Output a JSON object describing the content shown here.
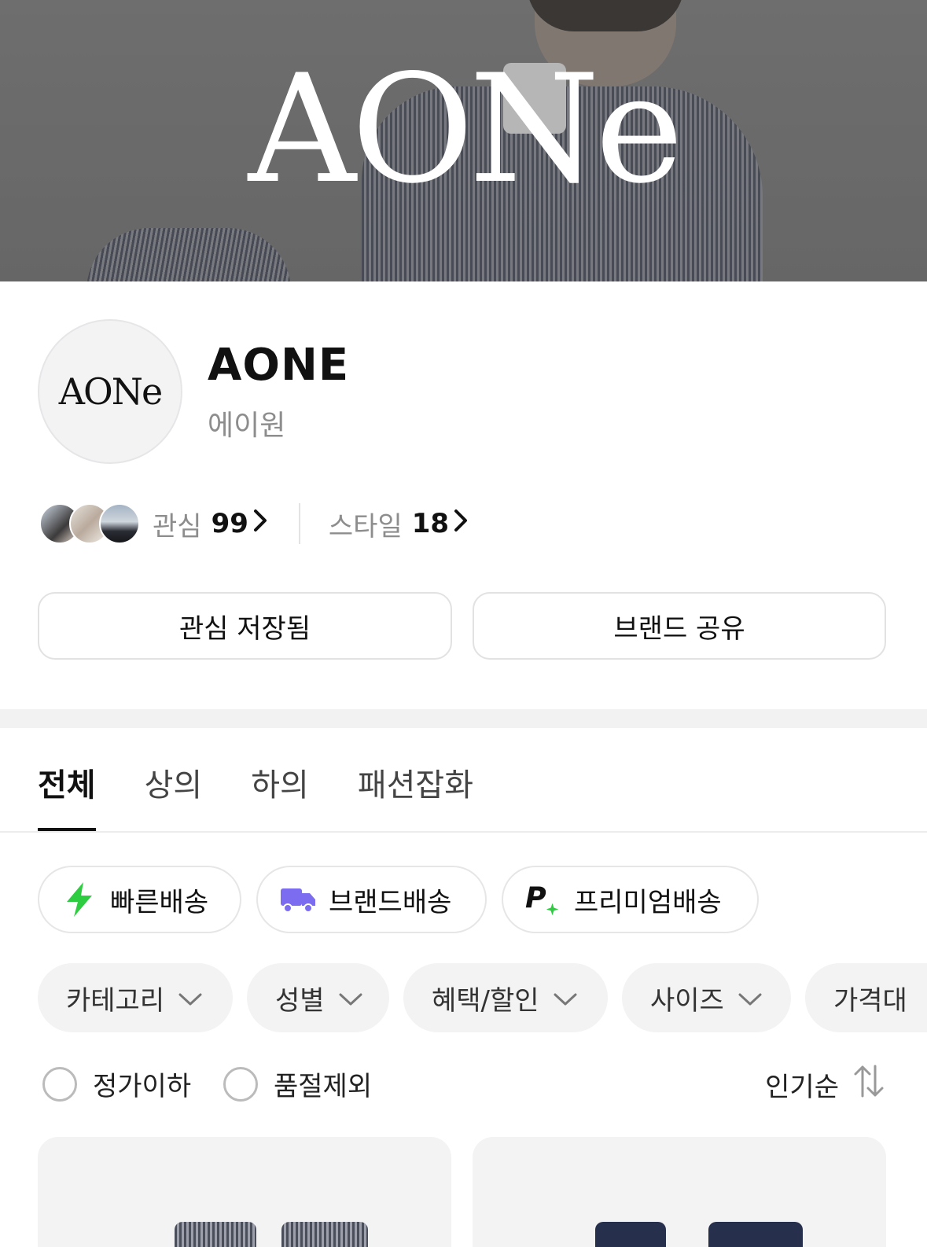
{
  "banner": {
    "logo_text": "AONe"
  },
  "brand": {
    "logo_text": "AONe",
    "name": "AONE",
    "name_kr": "에이원"
  },
  "stats": {
    "interest_label": "관심",
    "interest_count": "99",
    "style_label": "스타일",
    "style_count": "18"
  },
  "actions": {
    "saved_label": "관심 저장됨",
    "share_label": "브랜드 공유"
  },
  "tabs": [
    {
      "label": "전체",
      "active": true
    },
    {
      "label": "상의",
      "active": false
    },
    {
      "label": "하의",
      "active": false
    },
    {
      "label": "패션잡화",
      "active": false
    }
  ],
  "delivery_chips": [
    {
      "label": "빠른배송",
      "icon": "lightning-icon",
      "color": "#2ecc40"
    },
    {
      "label": "브랜드배송",
      "icon": "truck-icon",
      "color": "#7b6cf0"
    },
    {
      "label": "프리미엄배송",
      "icon": "premium-p-icon",
      "color": "#111111"
    }
  ],
  "filters": [
    {
      "label": "카테고리"
    },
    {
      "label": "성별"
    },
    {
      "label": "혜택/할인"
    },
    {
      "label": "사이즈"
    },
    {
      "label": "가격대"
    }
  ],
  "options": {
    "below_list_price": "정가이하",
    "exclude_soldout": "품절제외"
  },
  "sort": {
    "label": "인기순"
  }
}
